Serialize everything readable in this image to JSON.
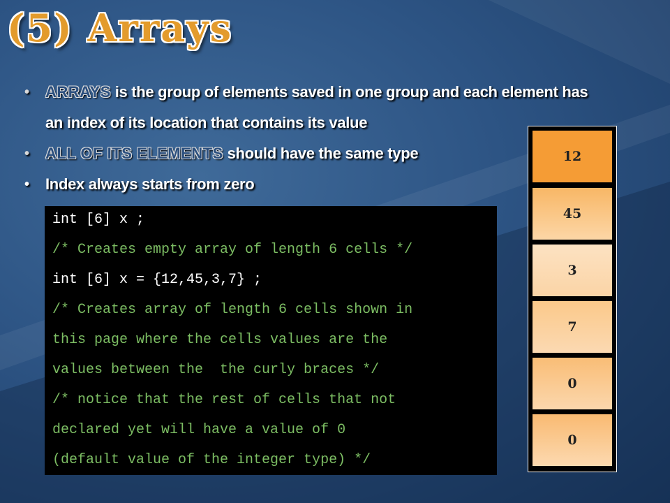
{
  "title": "(5) Arrays",
  "bullets": [
    {
      "highlight": "ARRAYS",
      "text": " is the group of elements saved in one group and each element has",
      "text2": "an index of its location that contains its value"
    },
    {
      "highlight": "ALL OF ITS ELEMENTS",
      "text": " should have the same type"
    },
    {
      "highlight": "",
      "text": "Index always starts from zero"
    }
  ],
  "bullet_glyph": "•",
  "code_lines": [
    "int [6] x ;",
    "/* Creates empty array of length 6 cells */",
    "int [6] x = {12,45,3,7} ;",
    "/* Creates array of length 6 cells shown in",
    "this page where the cells values are the",
    "values between the  the curly braces */",
    "/* notice that the rest of cells that not",
    "declared yet will have a value of 0",
    "(default value of the integer type) */"
  ],
  "array_cells": [
    "12",
    "45",
    "3",
    "7",
    "0",
    "0"
  ],
  "colors": {
    "title": "#e39b2c",
    "highlight": "#2b4f7e",
    "code_comment": "#7cbd63",
    "cell_top": "#f6a03a",
    "cell_light": "#fbd9b2"
  }
}
